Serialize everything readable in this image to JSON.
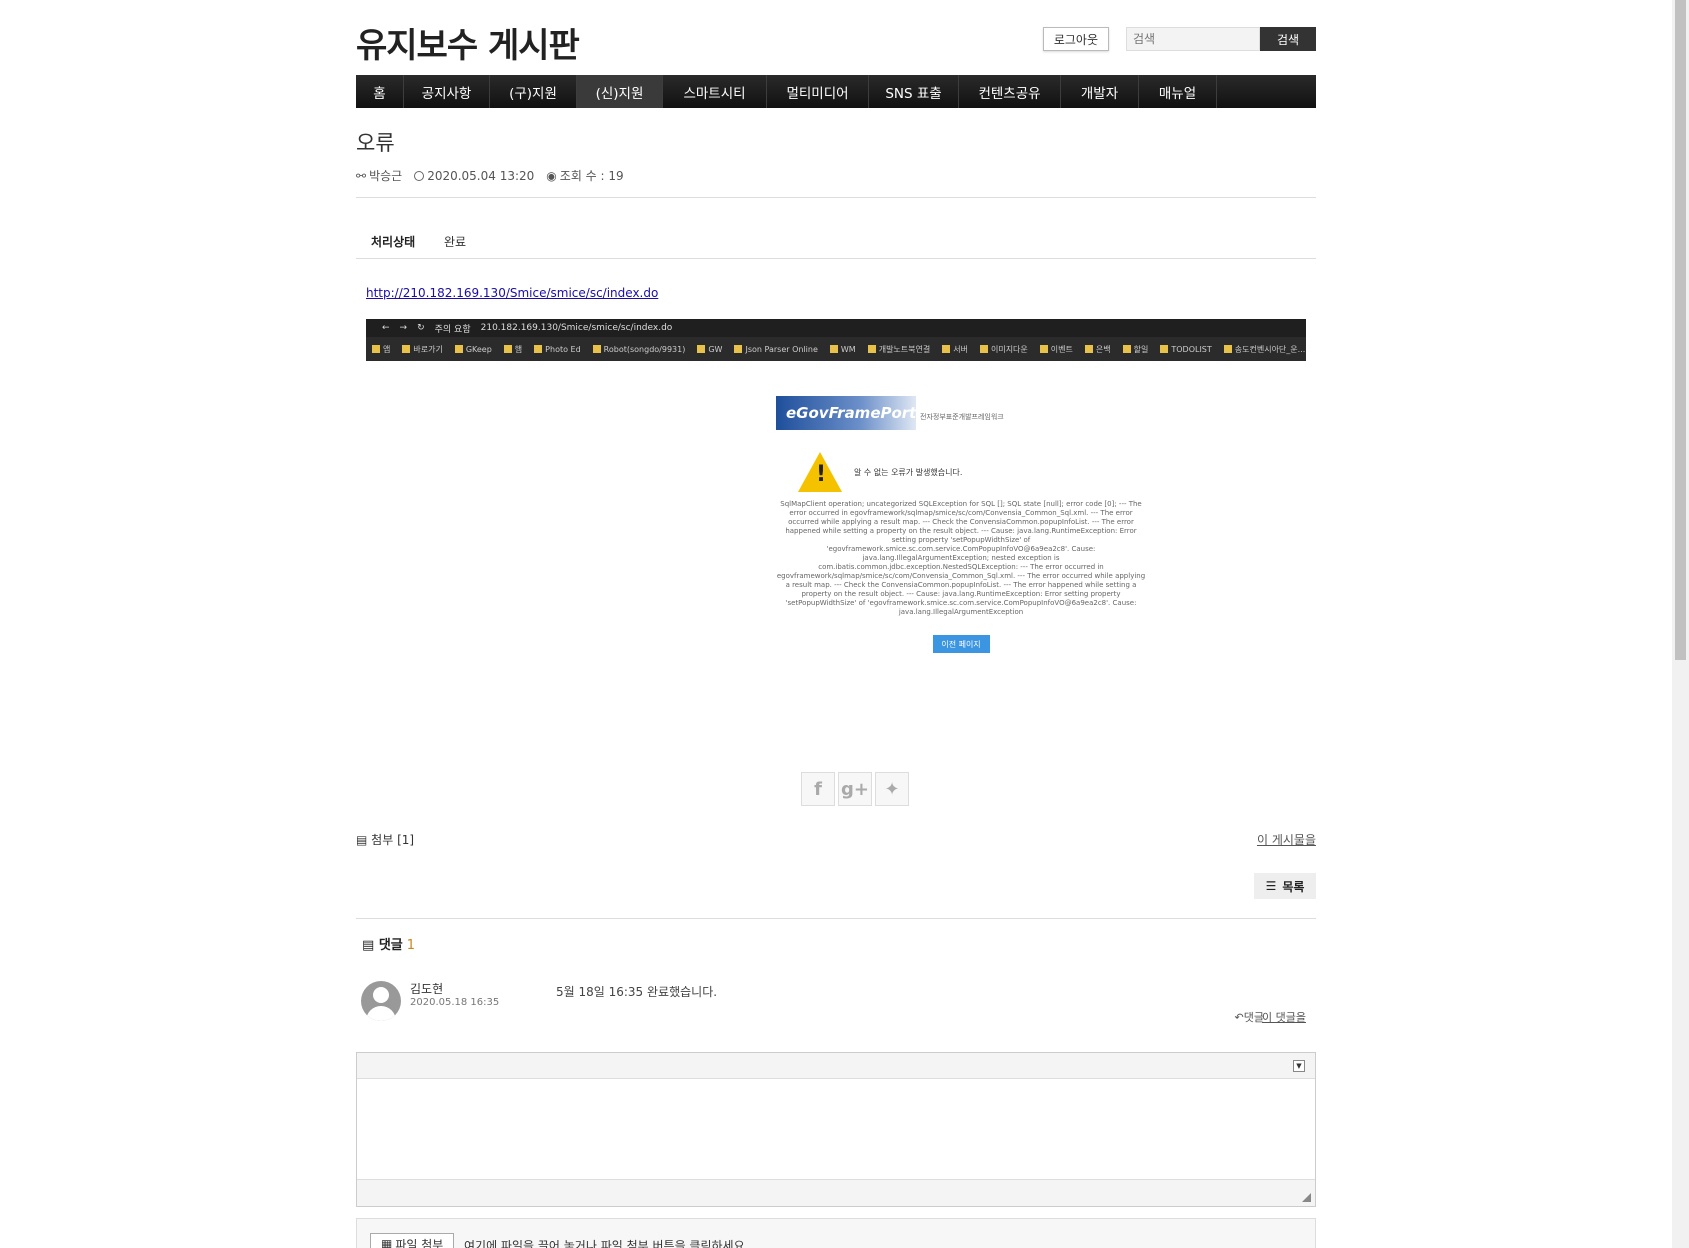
{
  "header": {
    "site_title": "유지보수 게시판",
    "logout_label": "로그아웃",
    "search_placeholder": "검색",
    "search_button": "검색"
  },
  "nav": {
    "items": [
      "홈",
      "공지사항",
      "(구)지원",
      "(신)지원",
      "스마트시티",
      "멀티미디어",
      "SNS 표출",
      "컨텐츠공유",
      "개발자",
      "매뉴얼"
    ],
    "active_index": 3
  },
  "post": {
    "title": "오류",
    "author": "박승근",
    "date": "2020.05.04 13:20",
    "views": "조회 수 : 19",
    "status_label": "처리상태",
    "status_value": "완료",
    "link": "http://210.182.169.130/Smice/smice/sc/index.do"
  },
  "embedded_image": {
    "address_warning": "주의 요함",
    "address_url": "210.182.169.130/Smice/smice/sc/index.do",
    "bookmarks": [
      "앱",
      "바로가기",
      "GKeep",
      "햄",
      "Photo Ed",
      "Robot(songdo/9931)",
      "GW",
      "Json Parser Online",
      "WM",
      "개발노트북연결",
      "서버",
      "이미지다운",
      "이벤트",
      "은백",
      "할일",
      "TODOLIST",
      "송도컨벤시아단_운..."
    ],
    "logo_text": "eGovFramePortal",
    "logo_sub": "전자정부표준개발프레임워크",
    "warn_message": "알 수 없는 오류가 발생했습니다.",
    "error_text": "SqlMapClient operation; uncategorized SQLException for SQL []; SQL state [null]; error code [0]; --- The error occurred in egovframework/sqlmap/smice/sc/com/Convensia_Common_Sql.xml. --- The error occurred while applying a result map. --- Check the ConvensiaCommon.popupInfoList. --- The error happened while setting a property on the result object. --- Cause: java.lang.RuntimeException: Error setting property 'setPopupWidthSize' of 'egovframework.smice.sc.com.service.ComPopupInfoVO@6a9ea2c8'. Cause: java.lang.IllegalArgumentException; nested exception is com.ibatis.common.jdbc.exception.NestedSQLException: --- The error occurred in egovframework/sqlmap/smice/sc/com/Convensia_Common_Sql.xml. --- The error occurred while applying a result map. --- Check the ConvensiaCommon.popupInfoList. --- The error happened while setting a property on the result object. --- Cause: java.lang.RuntimeException: Error setting property 'setPopupWidthSize' of 'egovframework.smice.sc.com.service.ComPopupInfoVO@6a9ea2c8'. Cause: java.lang.IllegalArgumentException",
    "prev_button": "이전 페이지"
  },
  "footer_tools": {
    "attach": "첨부 [1]",
    "this_post": "이 게시물을",
    "list_button": "목록"
  },
  "comments": {
    "heading": "댓글",
    "count": "1",
    "items": [
      {
        "author": "김도현",
        "date": "2020.05.18 16:35",
        "body": "5월 18일 16:35 완료했습니다.",
        "reply": "댓글",
        "this_comment": "이 댓글을"
      }
    ]
  },
  "upload": {
    "button": "파일 첨부",
    "hint": "여기에 파일을 끌어 놓거나 파일 첨부 버튼을 클릭하세요."
  },
  "colors": {
    "nav_bg": "#1a1a1a",
    "link": "#1a0dab",
    "accent_count": "#c8861f",
    "prev_button": "#3c95e0"
  }
}
